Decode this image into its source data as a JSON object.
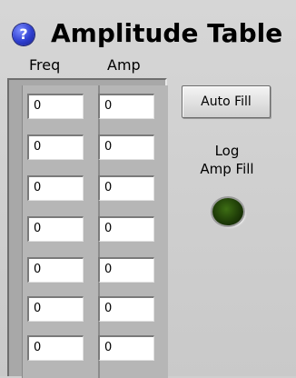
{
  "header": {
    "title": "Amplitude Table",
    "help_glyph": "?"
  },
  "columns": {
    "freq_label": "Freq",
    "amp_label": "Amp"
  },
  "rows": [
    {
      "freq": "0",
      "amp": "0"
    },
    {
      "freq": "0",
      "amp": "0"
    },
    {
      "freq": "0",
      "amp": "0"
    },
    {
      "freq": "0",
      "amp": "0"
    },
    {
      "freq": "0",
      "amp": "0"
    },
    {
      "freq": "0",
      "amp": "0"
    },
    {
      "freq": "0",
      "amp": "0"
    }
  ],
  "controls": {
    "auto_fill_label": "Auto Fill",
    "log_amp_fill_label_line1": "Log",
    "log_amp_fill_label_line2": "Amp Fill",
    "log_amp_fill_state": "off",
    "led_color": "#2a4f0c"
  },
  "icons": {
    "help": "help-question-icon"
  },
  "colors": {
    "panel_bg": "#cfcfcf",
    "help_icon": "#2e3ecf",
    "cell_bg": "#ffffff"
  }
}
